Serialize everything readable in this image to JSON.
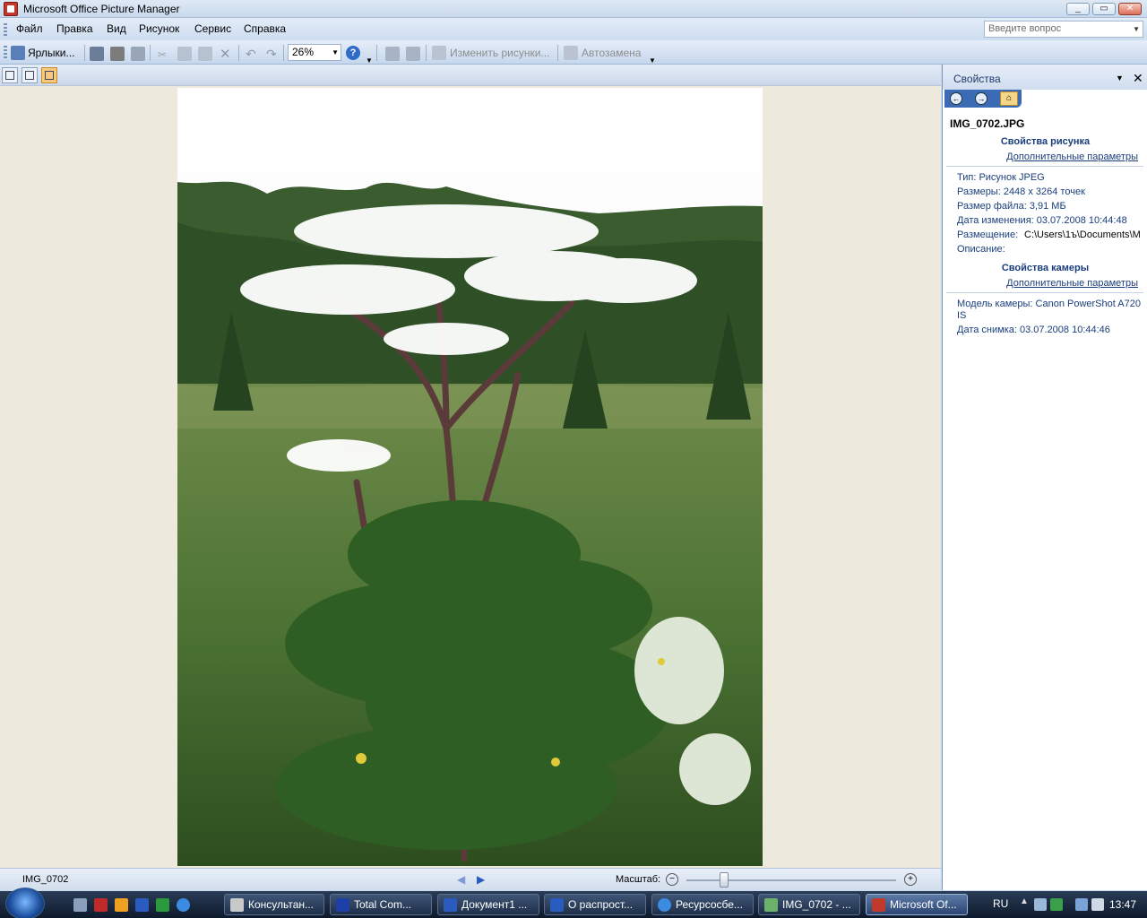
{
  "window": {
    "title": "Microsoft Office Picture Manager"
  },
  "menu": {
    "items": [
      "Файл",
      "Правка",
      "Вид",
      "Рисунок",
      "Сервис",
      "Справка"
    ],
    "help_placeholder": "Введите вопрос"
  },
  "toolbar": {
    "shortcuts_label": "Ярлыки...",
    "zoom_value": "26%",
    "edit_pictures_label": "Изменить рисунки...",
    "autocorrect_label": "Автозамена"
  },
  "status": {
    "filename": "IMG_0702",
    "zoom_label": "Масштаб:",
    "zoom_level": 0.18
  },
  "pane": {
    "title": "Свойства",
    "filename": "IMG_0702.JPG",
    "picture_section": {
      "title": "Свойства рисунка",
      "more_link": "Дополнительные параметры",
      "type": "Тип: Рисунок JPEG",
      "size": "Размеры: 2448 x 3264 точек",
      "file_size": "Размер файла: 3,91 МБ",
      "modified": "Дата изменения: 03.07.2008 10:44:48",
      "location_label": "Размещение:",
      "location_value": "C:\\Users\\1ъ\\Documents\\M",
      "description": "Описание:"
    },
    "camera_section": {
      "title": "Свойства камеры",
      "more_link": "Дополнительные параметры",
      "model_line1": "Модель камеры: Canon PowerShot A720",
      "model_line2": "IS",
      "shot_date": "Дата снимка: 03.07.2008 10:44:46"
    }
  },
  "taskbar": {
    "tasks": [
      "Консультан...",
      "Total Com...",
      "Документ1 ...",
      "О распрост...",
      "Ресурсосбе...",
      "IMG_0702 - ...",
      "Microsoft Of..."
    ],
    "language": "RU",
    "clock": "13:47"
  }
}
